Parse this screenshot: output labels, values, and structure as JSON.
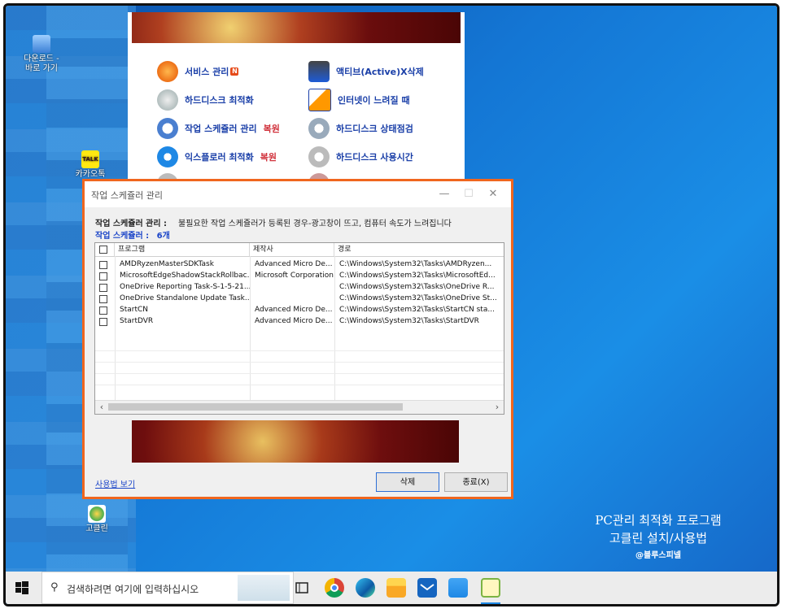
{
  "desktop": {
    "icons": [
      {
        "label": "다운로드 -\n바로 가기",
        "icon": "shortcut-folder-icon"
      },
      {
        "label": "카카오톡",
        "icon": "kakaotalk-icon",
        "badge": "TALK"
      },
      {
        "label": "고클린",
        "icon": "goclean-icon"
      }
    ]
  },
  "background_app": {
    "menu": [
      {
        "label": "서비스 관리",
        "badge": "N",
        "icon": "gear-service-icon"
      },
      {
        "label": "액티브(Active)X삭제",
        "icon": "activex-icon"
      },
      {
        "label": "하드디스크 최적화",
        "icon": "disk-optimize-icon"
      },
      {
        "label": "인터넷이 느려질 때",
        "icon": "internet-icon"
      },
      {
        "label": "작업 스케쥴러 관리",
        "extra": "복원",
        "icon": "scheduler-icon"
      },
      {
        "label": "하드디스크 상태점검",
        "icon": "disk-check-icon"
      },
      {
        "label": "익스플로러 최적화",
        "extra": "복원",
        "icon": "explorer-icon"
      },
      {
        "label": "하드디스크 사용시간",
        "icon": "disk-time-icon"
      }
    ]
  },
  "dialog": {
    "title": "작업 스케쥴러 관리",
    "info_label": "작업 스케쥴러 관리 :",
    "info_text": "불필요한 작업 스케쥴러가 등록된 경우-광고창이 뜨고, 컴퓨터 속도가 느려집니다",
    "count_label": "작업 스케쥴러 :",
    "count_value": "6개",
    "columns": [
      "프로그램",
      "제작사",
      "경로"
    ],
    "rows": [
      {
        "program": "AMDRyzenMasterSDKTask",
        "vendor": "Advanced Micro De...",
        "path": "C:\\Windows\\System32\\Tasks\\AMDRyzen..."
      },
      {
        "program": "MicrosoftEdgeShadowStackRollbac...",
        "vendor": "Microsoft Corporation",
        "path": "C:\\Windows\\System32\\Tasks\\MicrosoftEd..."
      },
      {
        "program": "OneDrive Reporting Task-S-1-5-21...",
        "vendor": "",
        "path": "C:\\Windows\\System32\\Tasks\\OneDrive R..."
      },
      {
        "program": "OneDrive Standalone Update Task...",
        "vendor": "",
        "path": "C:\\Windows\\System32\\Tasks\\OneDrive St..."
      },
      {
        "program": "StartCN",
        "vendor": "Advanced Micro De...",
        "path": "C:\\Windows\\System32\\Tasks\\StartCN sta..."
      },
      {
        "program": "StartDVR",
        "vendor": "Advanced Micro De...",
        "path": "C:\\Windows\\System32\\Tasks\\StartDVR"
      }
    ],
    "usage_link": "사용법 보기",
    "delete_button": "삭제",
    "close_button": "종료(X)"
  },
  "watermark": {
    "line1": "PC관리 최적화 프로그램",
    "line2": "고클린 설치/사용법",
    "credit": "@블루스피넬"
  },
  "taskbar": {
    "search_placeholder": "검색하려면 여기에 입력하십시오",
    "apps": [
      "task-view-icon",
      "chrome-icon",
      "edge-icon",
      "file-explorer-icon",
      "mail-icon",
      "store-icon",
      "goclean-taskbar-icon"
    ]
  },
  "colors": {
    "dialog_border": "#f0661e",
    "link_blue": "#1a44c8",
    "desktop_blue": "#1476d4"
  }
}
